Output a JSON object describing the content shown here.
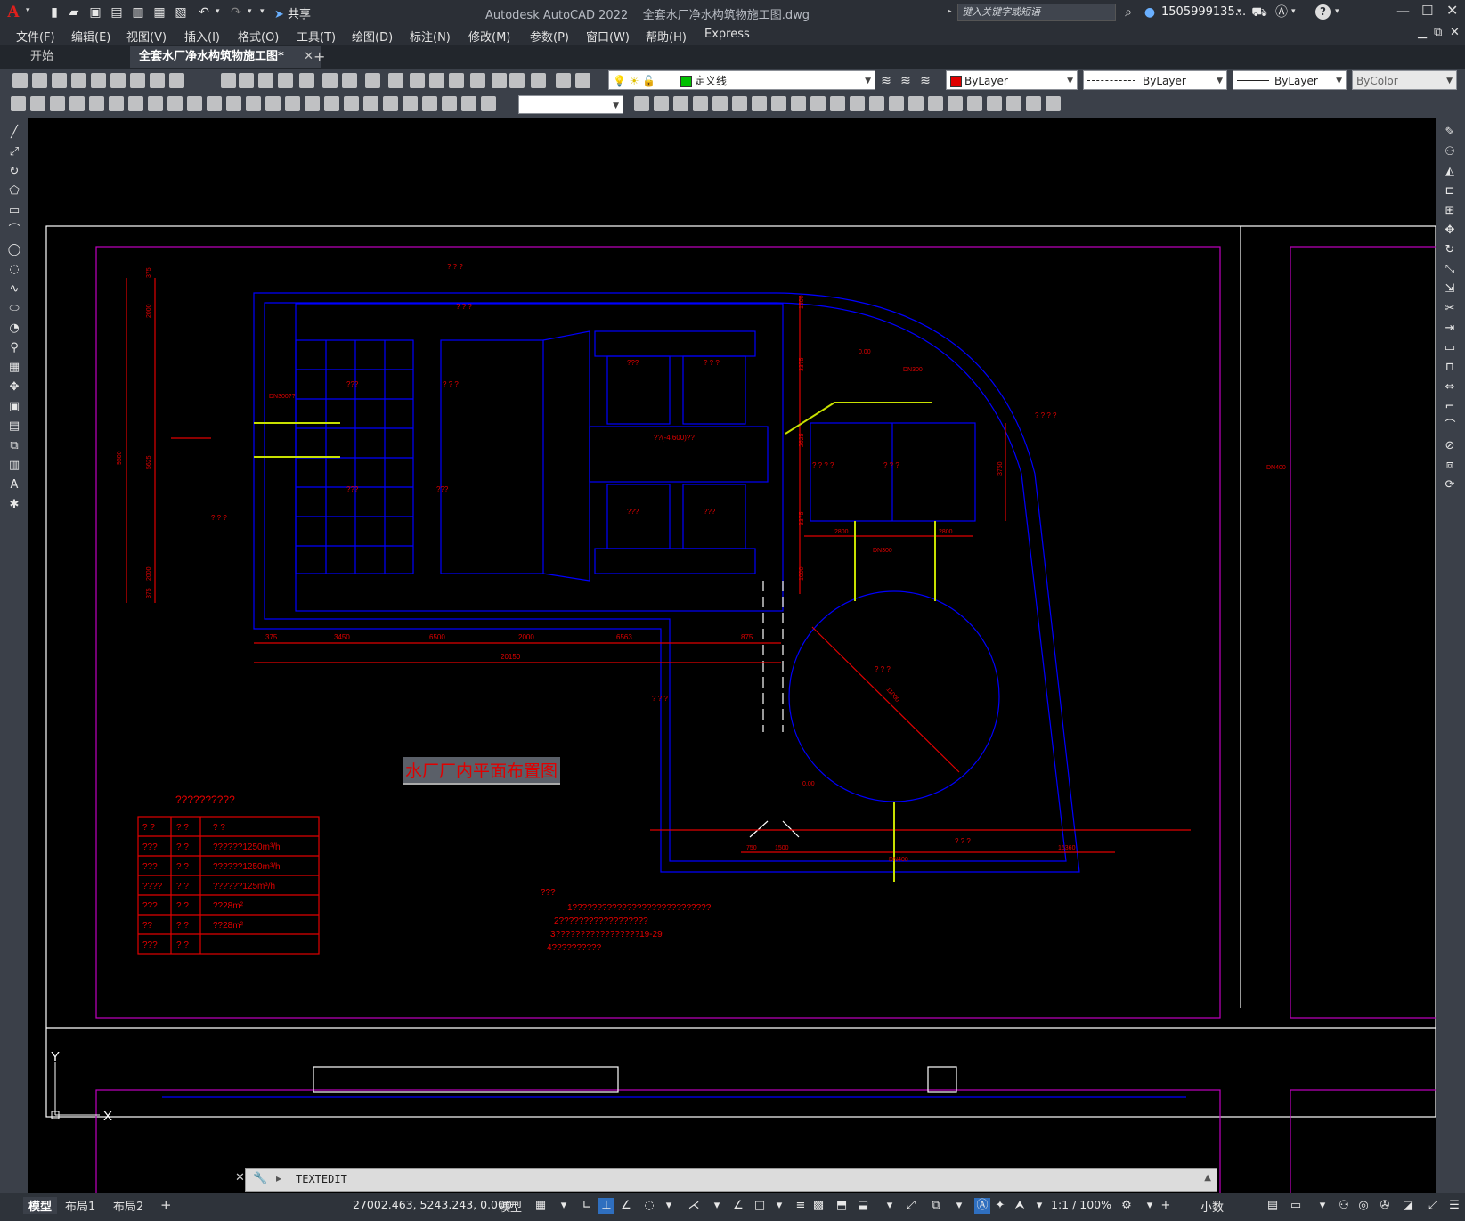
{
  "app": {
    "title": "Autodesk AutoCAD 2022",
    "filename": "全套水厂净水构筑物施工图.dwg",
    "share_label": "共享",
    "search_placeholder": "键入关键字或短语",
    "user": "1505999135...",
    "help_icon": "?"
  },
  "menu": [
    "文件(F)",
    "编辑(E)",
    "视图(V)",
    "插入(I)",
    "格式(O)",
    "工具(T)",
    "绘图(D)",
    "标注(N)",
    "修改(M)",
    "参数(P)",
    "窗口(W)",
    "帮助(H)",
    "Express"
  ],
  "tabs": [
    {
      "label": "开始",
      "active": false
    },
    {
      "label": "全套水厂净水构筑物施工图*",
      "active": true
    }
  ],
  "properties": {
    "layer": "定义线",
    "color": "ByLayer",
    "linetype": "ByLayer",
    "lineweight": "ByLayer",
    "plotstyle": "ByColor",
    "color_swatch": "#e00000",
    "layer_swatch": "#00c000"
  },
  "drawing": {
    "title": "水厂厂内平面布置图",
    "table_heading": "??????????",
    "table_rows": [
      [
        "? ?",
        "? ?",
        "?  ?"
      ],
      [
        "???",
        "? ?",
        "??????1250m³/h"
      ],
      [
        "???",
        "? ?",
        "??????1250m³/h"
      ],
      [
        "????",
        "? ?",
        "??????125m³/h"
      ],
      [
        "???",
        "? ?",
        "??28m²"
      ],
      [
        "??",
        "? ?",
        "??28m²"
      ],
      [
        "???",
        "? ?",
        ""
      ]
    ],
    "notes_heading": "???",
    "notes": [
      "1????????????????????????????",
      "2??????????????????",
      "3?????????????????19-29",
      "4??????????"
    ],
    "dims_bottom": [
      "375",
      "3450",
      "6500",
      "2000",
      "6563",
      "875"
    ],
    "dim_total": "20150",
    "dims_left": [
      "375",
      "2000",
      "9500",
      "5625",
      "2000",
      "375"
    ],
    "dims_right": [
      "1500",
      "3375",
      "2625",
      "3375",
      "1000"
    ],
    "dims_tank": [
      "2800",
      "2800",
      "3750"
    ],
    "dims_road": [
      "750",
      "1500",
      "15360"
    ],
    "pipe_labels": [
      "DN300??",
      "DN300",
      "DN300",
      "DN400",
      "DN400"
    ],
    "level_labels": [
      "0.00",
      "0.00"
    ],
    "center_label": "??(-4.600)??",
    "circle_dim": "11000",
    "room_labels": [
      "? ? ?",
      "? ? ?",
      "? ? ? ?",
      "? ? ?",
      "? ? ?",
      "? ? ? ?",
      "? ? ?",
      "? ? ?",
      "? ? ?"
    ],
    "cell_labels": [
      "???",
      "? ? ?",
      "???",
      "? ? ?",
      "???",
      "???",
      "???",
      "???"
    ]
  },
  "ucs": {
    "x": "X",
    "y": "Y"
  },
  "command": {
    "text": "TEXTEDIT"
  },
  "layouts": [
    "模型",
    "布局1",
    "布局2"
  ],
  "status": {
    "coords": "27002.463, 5243.243, 0.000",
    "space": "模型",
    "scale": "1:1 / 100%",
    "units": "小数"
  }
}
